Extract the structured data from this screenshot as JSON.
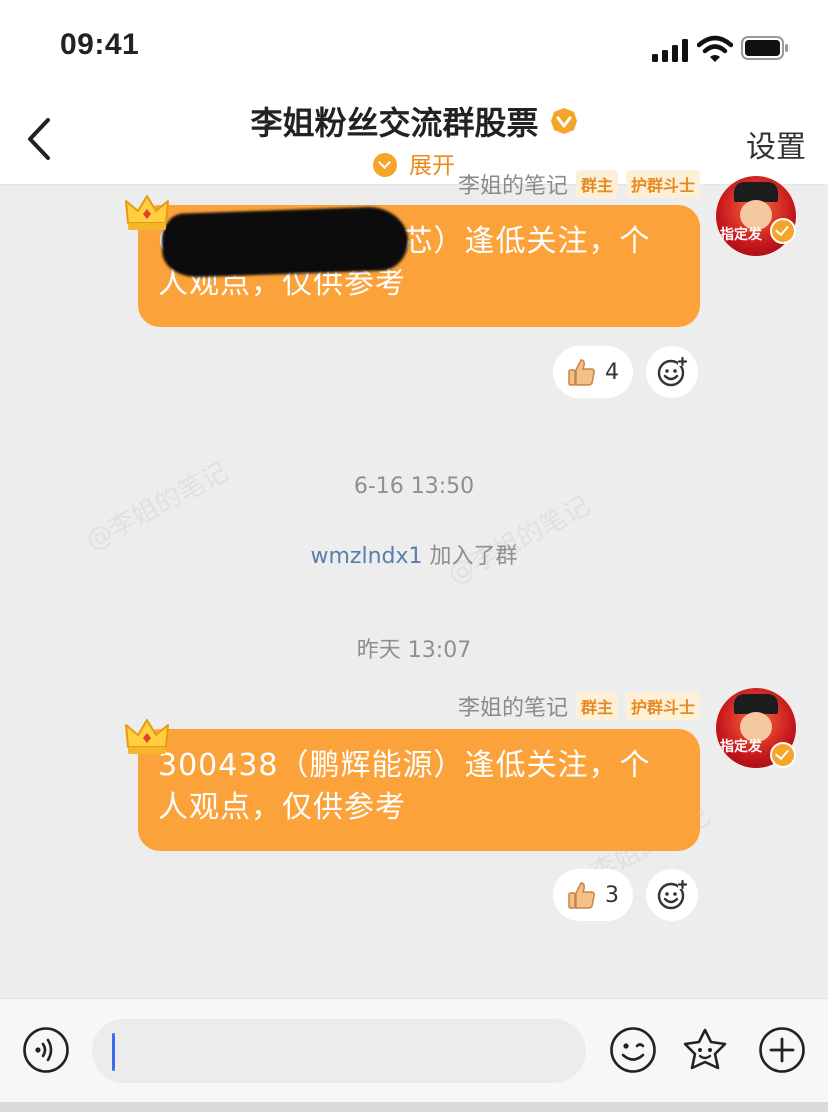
{
  "status_bar": {
    "time": "09:41"
  },
  "header": {
    "title": "李姐粉丝交流群股票",
    "expand_label": "展开",
    "settings_label": "设置"
  },
  "messages": [
    {
      "sender": "李姐的笔记",
      "tags": [
        "群主",
        "护群斗士"
      ],
      "text": "002245（蔚蓝锂芯）逢低关注，个人观点，仅供参考",
      "likes": "4",
      "avatar_text": "指定发"
    },
    {
      "sender": "李姐的笔记",
      "tags": [
        "群主",
        "护群斗士"
      ],
      "text": "300438（鹏辉能源）逢低关注，个人观点，仅供参考",
      "likes": "3",
      "avatar_text": "指定发"
    }
  ],
  "timestamps": [
    "6-16 13:50",
    "昨天 13:07"
  ],
  "system_message": {
    "user": "wmzlndx1",
    "action": " 加入了群"
  },
  "watermark_text": "@李姐的笔记",
  "colors": {
    "bubble": "#fba33a",
    "accent": "#ef8a1a",
    "link": "#5a7eaa"
  }
}
